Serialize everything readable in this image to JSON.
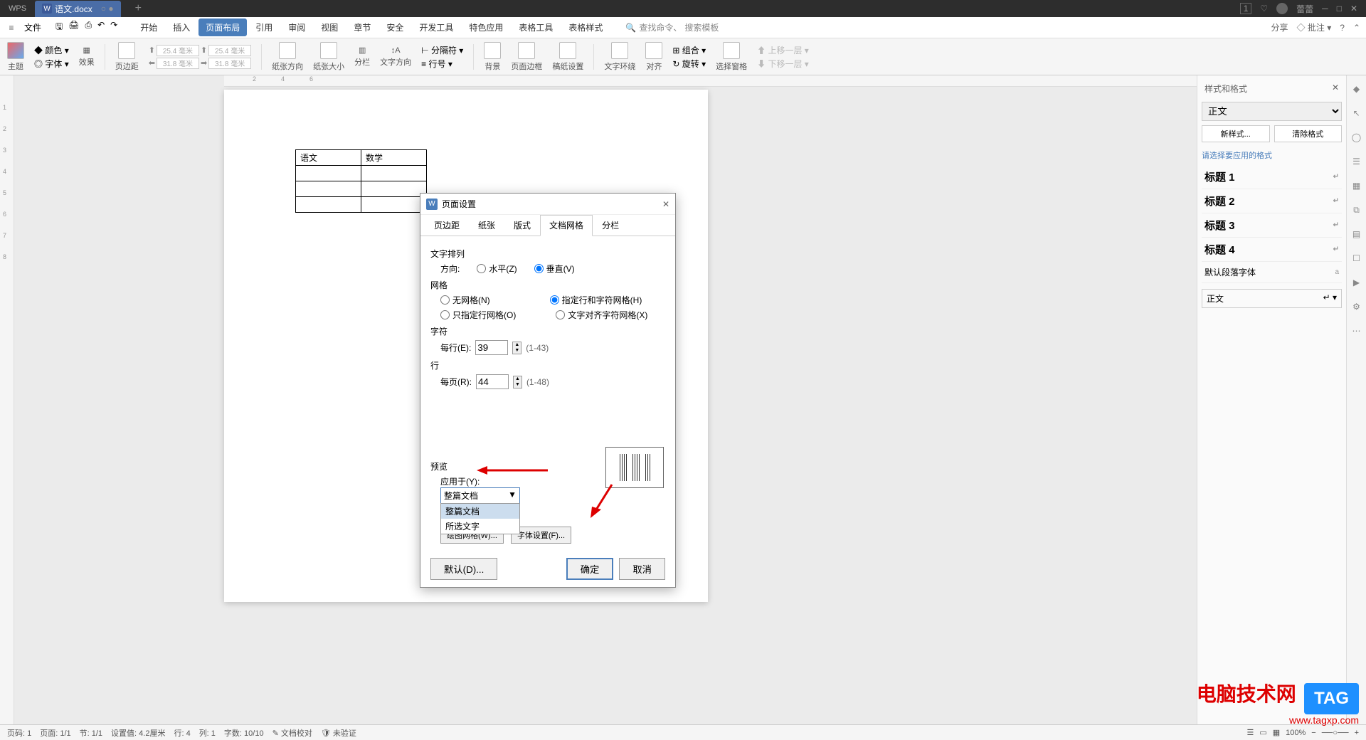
{
  "titlebar": {
    "app": "WPS",
    "doc": "语文.docx",
    "add": "+",
    "badge": "1",
    "user": "蕾蕾"
  },
  "menubar": {
    "file": "文件",
    "tabs": [
      "开始",
      "插入",
      "页面布局",
      "引用",
      "审阅",
      "视图",
      "章节",
      "安全",
      "开发工具",
      "特色应用",
      "表格工具",
      "表格样式"
    ],
    "active_index": 2,
    "search_icon_label": "查找命令、",
    "search_placeholder": "搜索模板",
    "share": "分享",
    "note": "批注",
    "help": "?"
  },
  "ribbon": {
    "theme": "主题",
    "color": "颜色",
    "font": "字体",
    "effect": "效果",
    "margins": "页边距",
    "top": "25.4 毫米",
    "bottom": "25.4 毫米",
    "left": "31.8 毫米",
    "right": "31.8 毫米",
    "orientation": "纸张方向",
    "size": "纸张大小",
    "columns": "分栏",
    "textdir": "文字方向",
    "linenum": "行号",
    "breaks": "分隔符",
    "background": "背景",
    "border": "页面边框",
    "writing": "稿纸设置",
    "wrap": "文字环绕",
    "align": "对齐",
    "rotate": "旋转",
    "pane": "选择窗格",
    "group": "组合",
    "forward": "上移一层",
    "backward": "下移一层"
  },
  "doc_table": {
    "h1": "语文",
    "h2": "数学"
  },
  "dialog": {
    "title": "页面设置",
    "tabs": [
      "页边距",
      "纸张",
      "版式",
      "文档网格",
      "分栏"
    ],
    "active_tab": 3,
    "text_arrange": "文字排列",
    "direction": "方向:",
    "horizontal": "水平(Z)",
    "vertical": "垂直(V)",
    "grid": "网格",
    "nogrid": "无网格(N)",
    "linegrid": "只指定行网格(O)",
    "charlinegrid": "指定行和字符网格(H)",
    "aligngrid": "文字对齐字符网格(X)",
    "char": "字符",
    "perline": "每行(E):",
    "perline_val": "39",
    "perline_hint": "(1-43)",
    "line": "行",
    "perpage": "每页(R):",
    "perpage_val": "44",
    "perpage_hint": "(1-48)",
    "preview": "预览",
    "apply_to": "应用于(Y):",
    "combo_val": "整篇文档",
    "dd1": "整篇文档",
    "dd2": "所选文字",
    "drawgrid": "绘图网格(W)...",
    "fontset": "字体设置(F)...",
    "default": "默认(D)...",
    "ok": "确定",
    "cancel": "取消"
  },
  "rightpanel": {
    "title": "样式和格式",
    "current": "正文",
    "newstyle": "新样式...",
    "clear": "清除格式",
    "prompt": "请选择要应用的格式",
    "h1": "标题 1",
    "h2": "标题 2",
    "h3": "标题 3",
    "h4": "标题 4",
    "default_font": "默认段落字体",
    "body": "正文"
  },
  "statusbar": {
    "page": "页码: 1",
    "pages": "页面: 1/1",
    "section": "节: 1/1",
    "pos": "设置值: 4.2厘米",
    "row": "行: 4",
    "col": "列: 1",
    "words": "字数: 10/10",
    "proof": "文档校对",
    "verify": "未验证",
    "zoom": "100%"
  },
  "watermark": {
    "t1": "电脑技术网",
    "t2": "www.tagxp.com",
    "tag": "TAG"
  }
}
